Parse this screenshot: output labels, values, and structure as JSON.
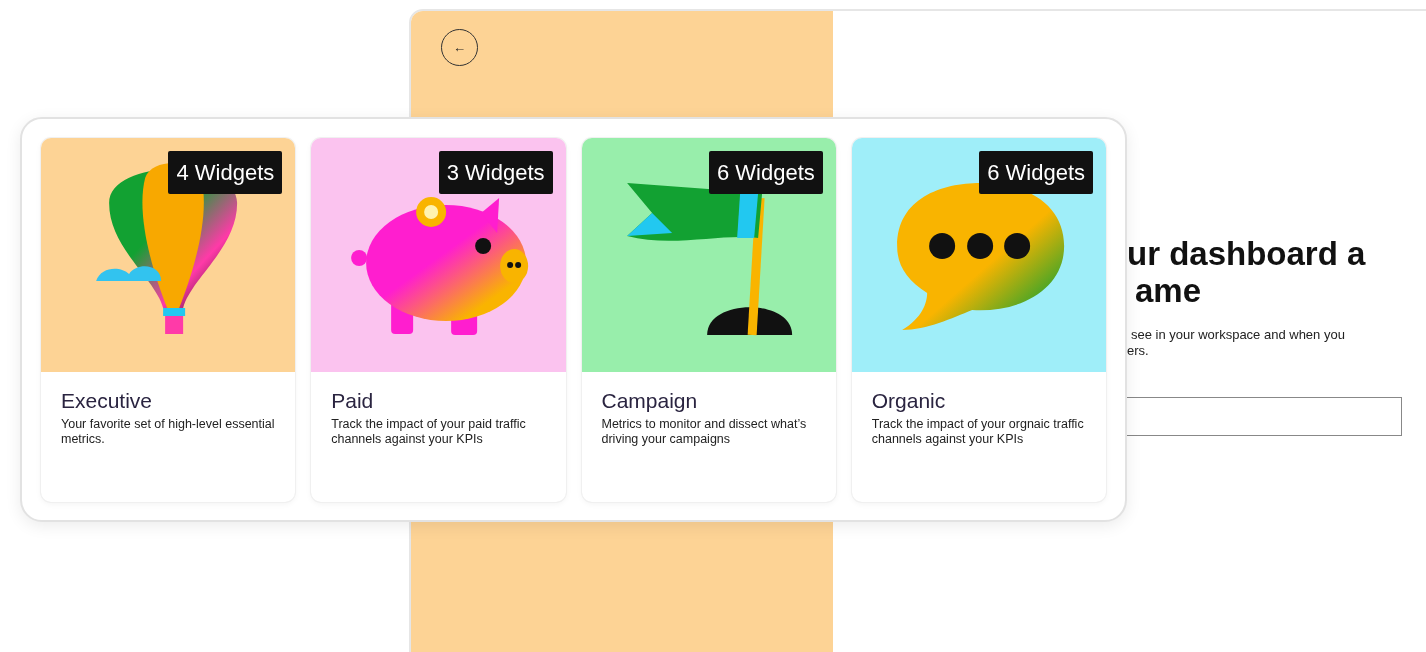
{
  "back_button": {
    "icon": "←"
  },
  "form": {
    "heading_lines": [
      "ur dashboard a",
      "ame"
    ],
    "description_lines": [
      "see in your workspace and when you",
      "ers."
    ],
    "name_field": {
      "kind": "text"
    }
  },
  "templates": [
    {
      "title": "Executive",
      "description": "Your favorite set of high-level essential metrics.",
      "badge": "4 Widgets",
      "color": "#fdd395",
      "kind": "balloon"
    },
    {
      "title": "Paid",
      "description": "Track the impact of your paid traffic channels against your KPIs",
      "badge": "3 Widgets",
      "color": "#fbc3ef",
      "kind": "piggy-bank"
    },
    {
      "title": "Campaign",
      "description": "Metrics to monitor and dissect what’s driving your campaigns",
      "badge": "6 Widgets",
      "color": "#98eeab",
      "kind": "flag"
    },
    {
      "title": "Organic",
      "description": "Track the impact of your orgnaic traffic channels against your KPIs",
      "badge": "6 Widgets",
      "color": "#9feef9",
      "kind": "speech-bubble"
    }
  ]
}
